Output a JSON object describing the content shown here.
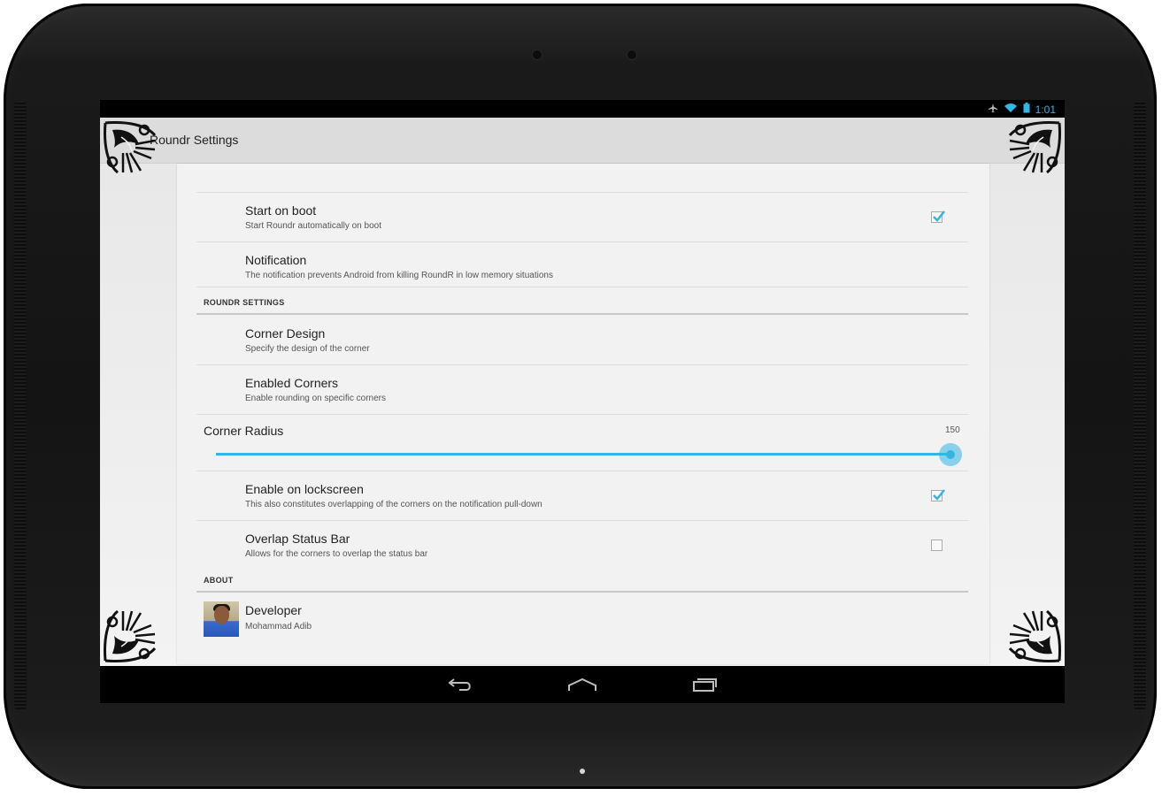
{
  "status_bar": {
    "time": "1:01"
  },
  "app": {
    "title": "Roundr Settings"
  },
  "preferences": {
    "start_on_boot": {
      "title": "Start on boot",
      "summary": "Start Roundr automatically on boot",
      "checked": true
    },
    "notification": {
      "title": "Notification",
      "summary": "The notification prevents Android from killing RoundR in low memory situations"
    },
    "roundr_settings_header": "ROUNDR SETTINGS",
    "corner_design": {
      "title": "Corner Design",
      "summary": "Specify the design of the corner"
    },
    "enabled_corners": {
      "title": "Enabled Corners",
      "summary": "Enable rounding on specific corners"
    },
    "corner_radius": {
      "title": "Corner Radius",
      "value": "150",
      "fraction": 1.0
    },
    "enable_on_lockscreen": {
      "title": "Enable on lockscreen",
      "summary": "This also constitutes overlapping of the corners on the notification pull-down",
      "checked": true
    },
    "overlap_status_bar": {
      "title": "Overlap Status Bar",
      "summary": "Allows for the corners to overlap the status bar",
      "checked": false
    },
    "about_header": "ABOUT",
    "developer": {
      "title": "Developer",
      "summary": "Mohammad Adib"
    }
  },
  "navigation": {
    "back": "back-icon",
    "home": "home-icon",
    "recents": "recents-icon"
  },
  "colors": {
    "accent": "#33b5e5",
    "action_bar": "#dcdcdc",
    "card": "#f2f2f2"
  }
}
